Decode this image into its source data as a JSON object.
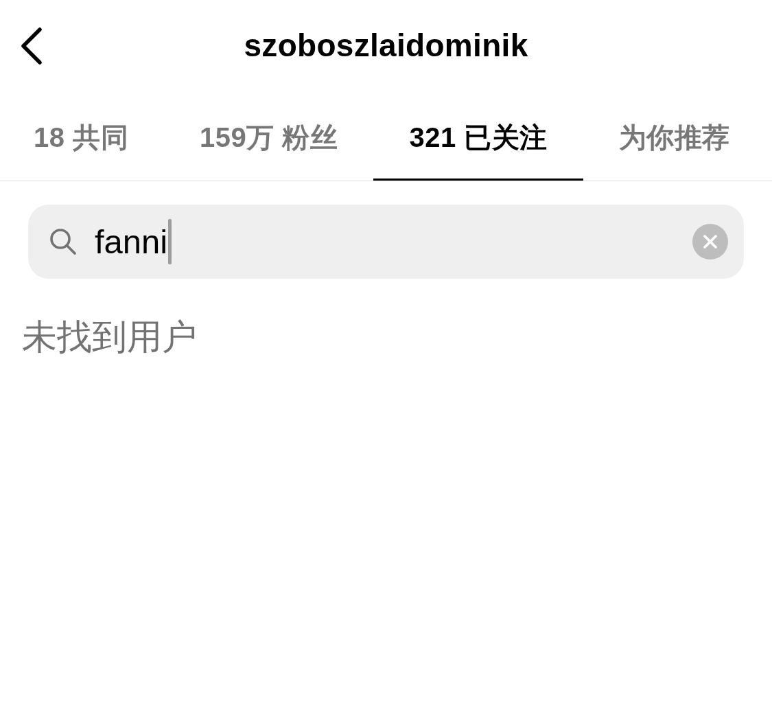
{
  "header": {
    "title": "szoboszlaidominik"
  },
  "tabs": [
    {
      "label": "18 共同",
      "selected": false
    },
    {
      "label": "159万 粉丝",
      "selected": false
    },
    {
      "label": "321 已关注",
      "selected": true
    },
    {
      "label": "为你推荐",
      "selected": false
    }
  ],
  "search": {
    "value": "fanni",
    "focused": true
  },
  "message": "未找到用户"
}
